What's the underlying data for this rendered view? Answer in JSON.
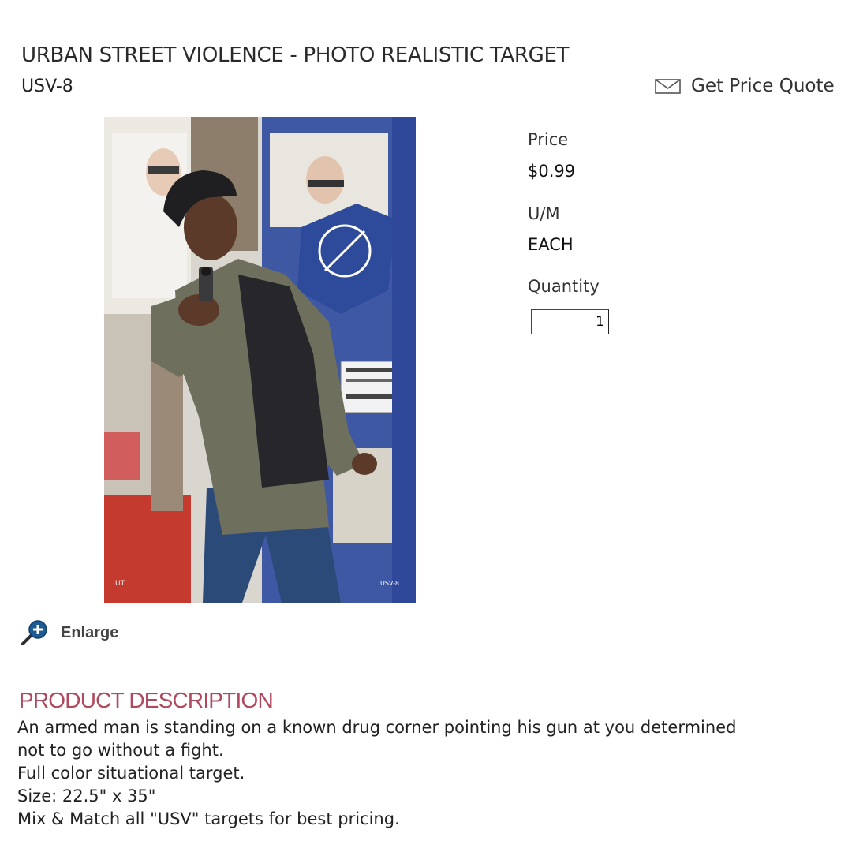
{
  "product": {
    "title": "URBAN STREET VIOLENCE - PHOTO REALISTIC TARGET",
    "sku": "USV-8",
    "image_alt": "Armed man pointing a handgun in front of a wall covered with torn posters",
    "image_small_text": "USV-8"
  },
  "quote": {
    "label": "Get Price Quote",
    "icon": "envelope-icon"
  },
  "pricing": {
    "price_label": "Price",
    "price_value": "$0.99",
    "um_label": "U/M",
    "um_value": "EACH",
    "quantity_label": "Quantity",
    "quantity_value": "1"
  },
  "enlarge": {
    "label": "Enlarge",
    "icon": "magnifier-plus-icon",
    "accent": "#1e5a94"
  },
  "description": {
    "heading": "PRODUCT DESCRIPTION",
    "heading_color": "#b0495e",
    "lines": [
      "An armed man is standing on a known drug corner pointing his gun at you determined",
      "not to go without a fight.",
      "Full color situational target.",
      "Size: 22.5\" x 35\"",
      "Mix & Match all \"USV\" targets for best pricing."
    ]
  }
}
